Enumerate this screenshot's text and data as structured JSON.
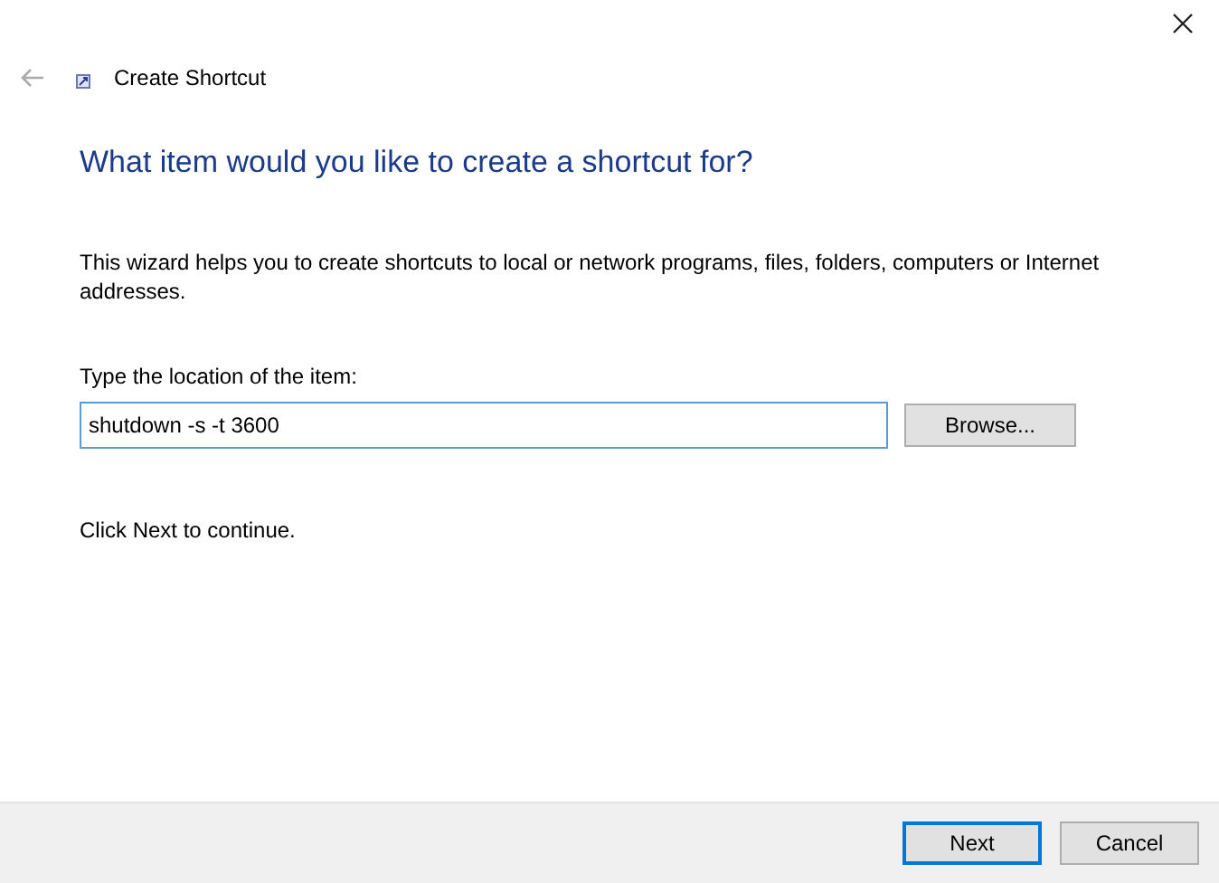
{
  "window": {
    "title": "Create Shortcut"
  },
  "heading": "What item would you like to create a shortcut for?",
  "description": "This wizard helps you to create shortcuts to local or network programs, files, folders, computers or Internet addresses.",
  "location": {
    "label": "Type the location of the item:",
    "value": "shutdown -s -t 3600",
    "browse_button": "Browse..."
  },
  "hint": "Click Next to continue.",
  "buttons": [
    {
      "label": "Next",
      "default": true
    },
    {
      "label": "Cancel",
      "default": false
    }
  ]
}
